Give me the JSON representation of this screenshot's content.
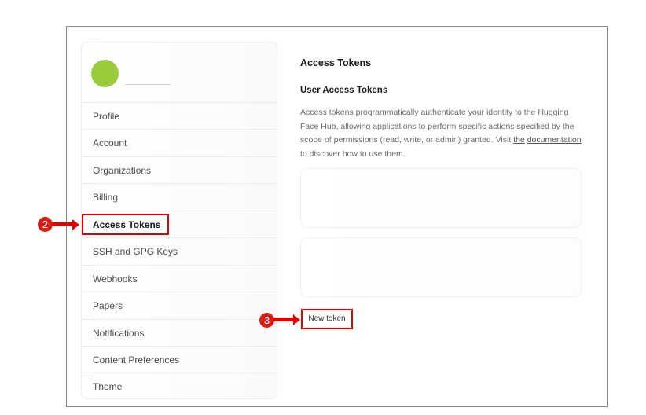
{
  "sidebar": {
    "items": [
      {
        "label": "Profile"
      },
      {
        "label": "Account"
      },
      {
        "label": "Organizations"
      },
      {
        "label": "Billing"
      },
      {
        "label": "Access Tokens"
      },
      {
        "label": "SSH and GPG Keys"
      },
      {
        "label": "Webhooks"
      },
      {
        "label": "Papers"
      },
      {
        "label": "Notifications"
      },
      {
        "label": "Content Preferences"
      },
      {
        "label": "Theme"
      }
    ],
    "active_item": "Access Tokens"
  },
  "main": {
    "title": "Access Tokens",
    "subtitle": "User Access Tokens",
    "description_text": "Access tokens programmatically authenticate your identity to the Hugging Face Hub, allowing applications to perform specific actions specified by the scope of permissions (read, write, or admin) granted. Visit ",
    "link_the": "the",
    "link_documentation": "documentation",
    "description_tail": " to discover how to use them.",
    "new_token_label": "New token"
  },
  "annotations": {
    "step2": "2",
    "step3": "3",
    "highlight_color": "#e00000"
  },
  "colors": {
    "avatar": "#9acb3c",
    "marker": "#d91e18"
  }
}
